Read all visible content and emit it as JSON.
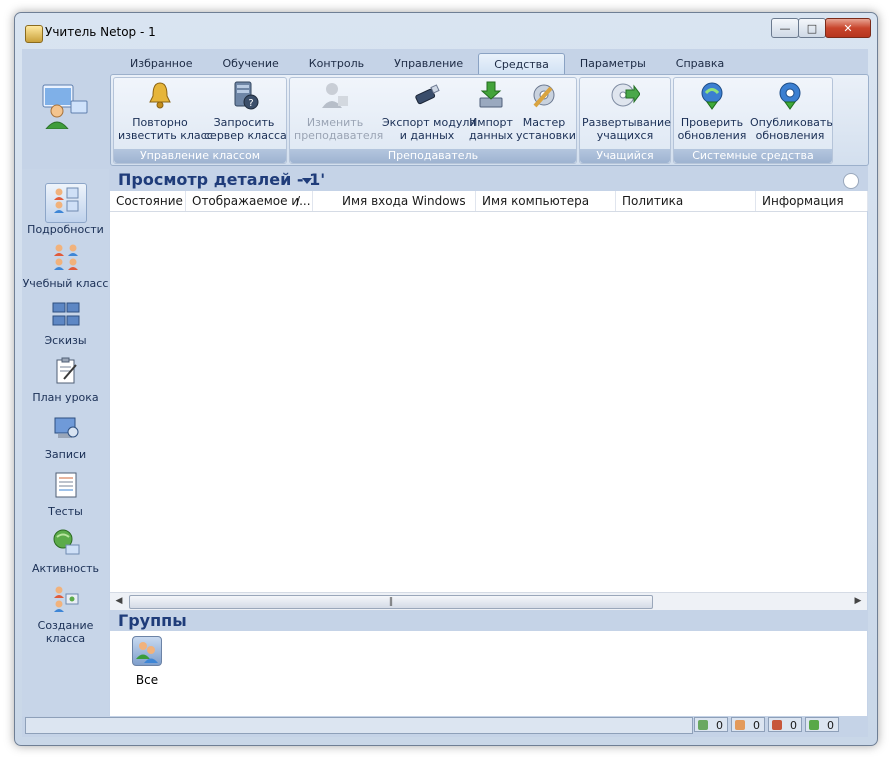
{
  "window": {
    "title": "Учитель Netop - 1"
  },
  "tabs": [
    "Избранное",
    "Обучение",
    "Контроль",
    "Управление",
    "Средства",
    "Параметры",
    "Справка"
  ],
  "active_tab": "Средства",
  "ribbon": {
    "groups": [
      {
        "label": "Управление классом",
        "buttons": [
          {
            "line1": "Повторно",
            "line2": "известить класс",
            "icon": "bell-icon"
          },
          {
            "line1": "Запросить",
            "line2": "сервер класса",
            "icon": "server-query-icon"
          }
        ]
      },
      {
        "label": "Преподаватель",
        "buttons": [
          {
            "line1": "Изменить",
            "line2": "преподавателя",
            "icon": "change-teacher-icon",
            "disabled": true
          },
          {
            "line1": "Экспорт модуля",
            "line2": "и данных",
            "icon": "export-usb-icon"
          },
          {
            "line1": "Импорт",
            "line2": "данных",
            "icon": "import-icon"
          },
          {
            "line1": "Мастер",
            "line2": "установки",
            "icon": "setup-wizard-icon"
          }
        ]
      },
      {
        "label": "Учащийся",
        "buttons": [
          {
            "line1": "Развертывание",
            "line2": "учащихся",
            "icon": "deploy-disc-icon"
          }
        ]
      },
      {
        "label": "Системные средства",
        "buttons": [
          {
            "line1": "Проверить",
            "line2": "обновления",
            "icon": "check-updates-icon"
          },
          {
            "line1": "Опубликовать",
            "line2": "обновления",
            "icon": "publish-updates-icon"
          }
        ]
      }
    ]
  },
  "sidebar": {
    "items": [
      {
        "label": "Подробности",
        "icon": "details-icon",
        "active": true
      },
      {
        "label": "Учебный класс",
        "icon": "classroom-icon"
      },
      {
        "label": "Эскизы",
        "icon": "thumbnails-icon"
      },
      {
        "label": "План урока",
        "icon": "lesson-plan-icon"
      },
      {
        "label": "Записи",
        "icon": "recordings-icon"
      },
      {
        "label": "Тесты",
        "icon": "tests-icon"
      },
      {
        "label": "Активность",
        "icon": "activity-icon"
      },
      {
        "label": "Создание класса",
        "icon": "create-class-icon"
      }
    ]
  },
  "view": {
    "title": "Просмотр деталей - 1'",
    "columns": [
      "Состояние",
      "Отображаемое и...",
      "Имя входа Windows",
      "Имя компьютера",
      "Политика",
      "Информация"
    ],
    "sort_indicator": "/"
  },
  "groups_panel": {
    "title": "Группы",
    "items": [
      {
        "label": "Все",
        "icon": "all-group-icon"
      }
    ]
  },
  "statusbar": {
    "counts": [
      "0",
      "0",
      "0",
      "0"
    ]
  }
}
